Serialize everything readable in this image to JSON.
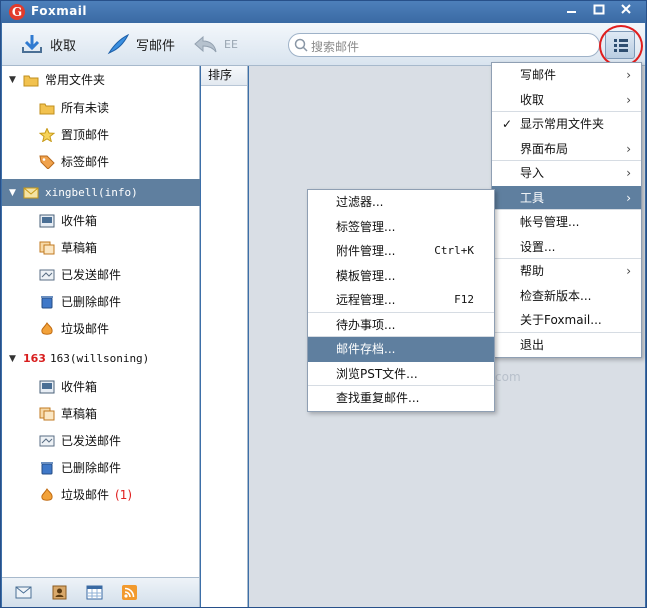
{
  "app": {
    "title": "Foxmail",
    "logo_letter": "G"
  },
  "toolbar": {
    "receive_label": "收取",
    "compose_label": "写邮件",
    "reply_label": "EE",
    "search_placeholder": "搜索邮件"
  },
  "sidebar": {
    "favorites": {
      "label": "常用文件夹",
      "items": [
        {
          "label": "所有未读",
          "icon": "folder-icon"
        },
        {
          "label": "置顶邮件",
          "icon": "star-icon"
        },
        {
          "label": "标签邮件",
          "icon": "tag-icon"
        }
      ]
    },
    "account1": {
      "label": "xingbell(info)",
      "items": [
        {
          "label": "收件箱",
          "icon": "inbox-icon"
        },
        {
          "label": "草稿箱",
          "icon": "drafts-icon"
        },
        {
          "label": "已发送邮件",
          "icon": "sent-icon"
        },
        {
          "label": "已删除邮件",
          "icon": "trash-icon"
        },
        {
          "label": "垃圾邮件",
          "icon": "spam-icon"
        }
      ]
    },
    "account2": {
      "brand": "163",
      "label": "163(willsoning)",
      "items": [
        {
          "label": "收件箱",
          "icon": "inbox-icon"
        },
        {
          "label": "草稿箱",
          "icon": "drafts-icon"
        },
        {
          "label": "已发送邮件",
          "icon": "sent-icon"
        },
        {
          "label": "已删除邮件",
          "icon": "trash-icon"
        },
        {
          "label": "垃圾邮件",
          "icon": "spam-icon",
          "badge": "(1)"
        }
      ]
    }
  },
  "list": {
    "sort_header": "排序"
  },
  "watermark": "com",
  "main_menu": [
    {
      "label": "写邮件",
      "arrow": "›"
    },
    {
      "label": "收取",
      "arrow": "›"
    },
    {
      "label": "显示常用文件夹",
      "check": "✓"
    },
    {
      "label": "界面布局",
      "arrow": "›"
    },
    {
      "label": "导入",
      "arrow": "›"
    },
    {
      "label": "工具",
      "arrow": "›",
      "active": true
    },
    {
      "label": "帐号管理..."
    },
    {
      "label": "设置..."
    },
    {
      "label": "帮助",
      "arrow": "›"
    },
    {
      "label": "检查新版本..."
    },
    {
      "label": "关于Foxmail..."
    },
    {
      "label": "退出"
    }
  ],
  "tools_menu": [
    {
      "label": "过滤器..."
    },
    {
      "label": "标签管理..."
    },
    {
      "label": "附件管理...",
      "shortcut": "Ctrl+K"
    },
    {
      "label": "模板管理..."
    },
    {
      "label": "远程管理...",
      "shortcut": "F12"
    },
    {
      "label": "待办事项..."
    },
    {
      "label": "邮件存档...",
      "active": true
    },
    {
      "label": "浏览PST文件..."
    },
    {
      "label": "查找重复邮件..."
    }
  ],
  "colors": {
    "accent": "#5f7f9f",
    "window": "#3d6fa8",
    "badge": "#e02020",
    "highlight_ring": "#e01e1e"
  }
}
